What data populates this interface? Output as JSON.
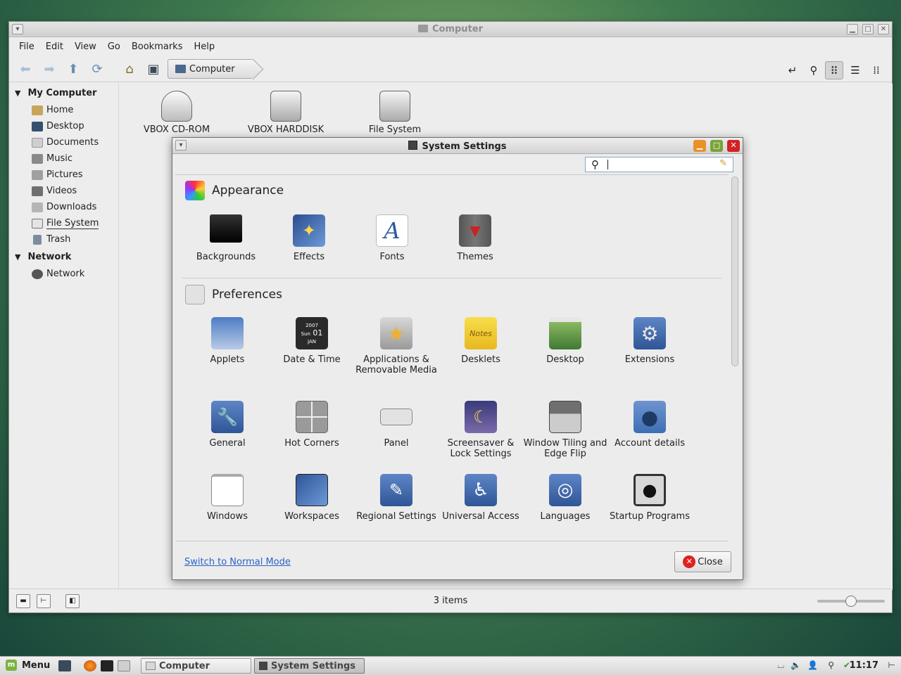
{
  "file_manager": {
    "window_title": "Computer",
    "menu": [
      "File",
      "Edit",
      "View",
      "Go",
      "Bookmarks",
      "Help"
    ],
    "breadcrumb": "Computer",
    "sidebar": {
      "sections": [
        {
          "title": "My Computer",
          "items": [
            "Home",
            "Desktop",
            "Documents",
            "Music",
            "Pictures",
            "Videos",
            "Downloads",
            "File System",
            "Trash"
          ]
        },
        {
          "title": "Network",
          "items": [
            "Network"
          ]
        }
      ],
      "selected": "File System"
    },
    "drives": [
      "VBOX CD-ROM",
      "VBOX HARDDISK",
      "File System"
    ],
    "status": "3 items",
    "zoom_level": 0.5
  },
  "settings": {
    "title": "System Settings",
    "search_placeholder": "",
    "sections": [
      {
        "title": "Appearance",
        "items": [
          "Backgrounds",
          "Effects",
          "Fonts",
          "Themes"
        ]
      },
      {
        "title": "Preferences",
        "items": [
          "Applets",
          "Date & Time",
          "Applications & Removable Media",
          "Desklets",
          "Desktop",
          "Extensions",
          "General",
          "Hot Corners",
          "Panel",
          "Screensaver & Lock Settings",
          "Window Tiling and Edge Flip",
          "Account details",
          "Windows",
          "Workspaces",
          "Regional Settings",
          "Universal Access",
          "Languages",
          "Startup Programs"
        ]
      }
    ],
    "date_icon": {
      "year": "2007",
      "day_name": "Sun",
      "day": "01",
      "month": "JAN"
    },
    "desklets_icon_text": "Notes",
    "footer_link": "Switch to Normal Mode",
    "close_label": "Close"
  },
  "taskbar": {
    "menu_label": "Menu",
    "tasks": [
      "Computer",
      "System Settings"
    ],
    "active_task": "System Settings",
    "clock": "11:17"
  },
  "colors": {
    "accent": "#3d6fb4",
    "link": "#2a63c7",
    "close_red": "#d22222",
    "mint_green": "#7cb342"
  }
}
